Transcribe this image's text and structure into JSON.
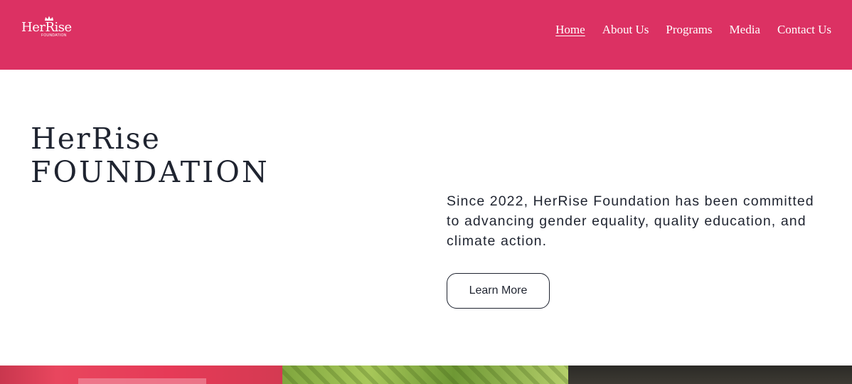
{
  "header": {
    "brand_color": "#dc3163",
    "logo": {
      "text": "HerRise",
      "subtext": "FOUNDATION"
    },
    "nav": [
      {
        "label": "Home",
        "active": true
      },
      {
        "label": "About Us",
        "active": false
      },
      {
        "label": "Programs",
        "active": false
      },
      {
        "label": "Media",
        "active": false
      },
      {
        "label": "Contact Us",
        "active": false
      }
    ]
  },
  "hero": {
    "title_line1": "HerRise",
    "title_line2": "FOUNDATION",
    "description": "Since 2022, HerRise Foundation has been committed to advancing gender equality, quality education, and climate action.",
    "cta_label": "Learn More"
  },
  "gallery": {
    "images": [
      "banner-photo",
      "tree-photo",
      "indoor-photo"
    ]
  }
}
